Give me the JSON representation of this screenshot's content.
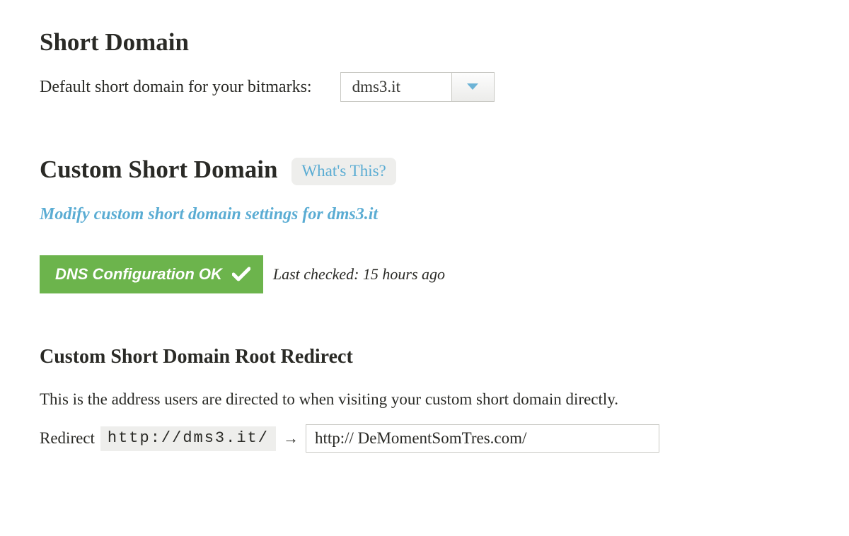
{
  "section1": {
    "heading": "Short Domain",
    "label": "Default short domain for your bitmarks:",
    "dropdown_value": "dms3.it"
  },
  "section2": {
    "heading": "Custom Short Domain",
    "whats_this": "What's This?",
    "modify_link": "Modify custom short domain settings for dms3.it",
    "dns_status": "DNS Configuration OK",
    "last_checked": "Last checked: 15 hours ago"
  },
  "section3": {
    "heading": "Custom Short Domain Root Redirect",
    "description": "This is the address users are directed to when visiting your custom short domain directly.",
    "redirect_label": "Redirect",
    "redirect_source": "http://dms3.it/",
    "arrow": "→",
    "redirect_target": "http:// DeMomentSomTres.com/"
  },
  "colors": {
    "link": "#5aacd3",
    "badge_green": "#6cb44c"
  }
}
